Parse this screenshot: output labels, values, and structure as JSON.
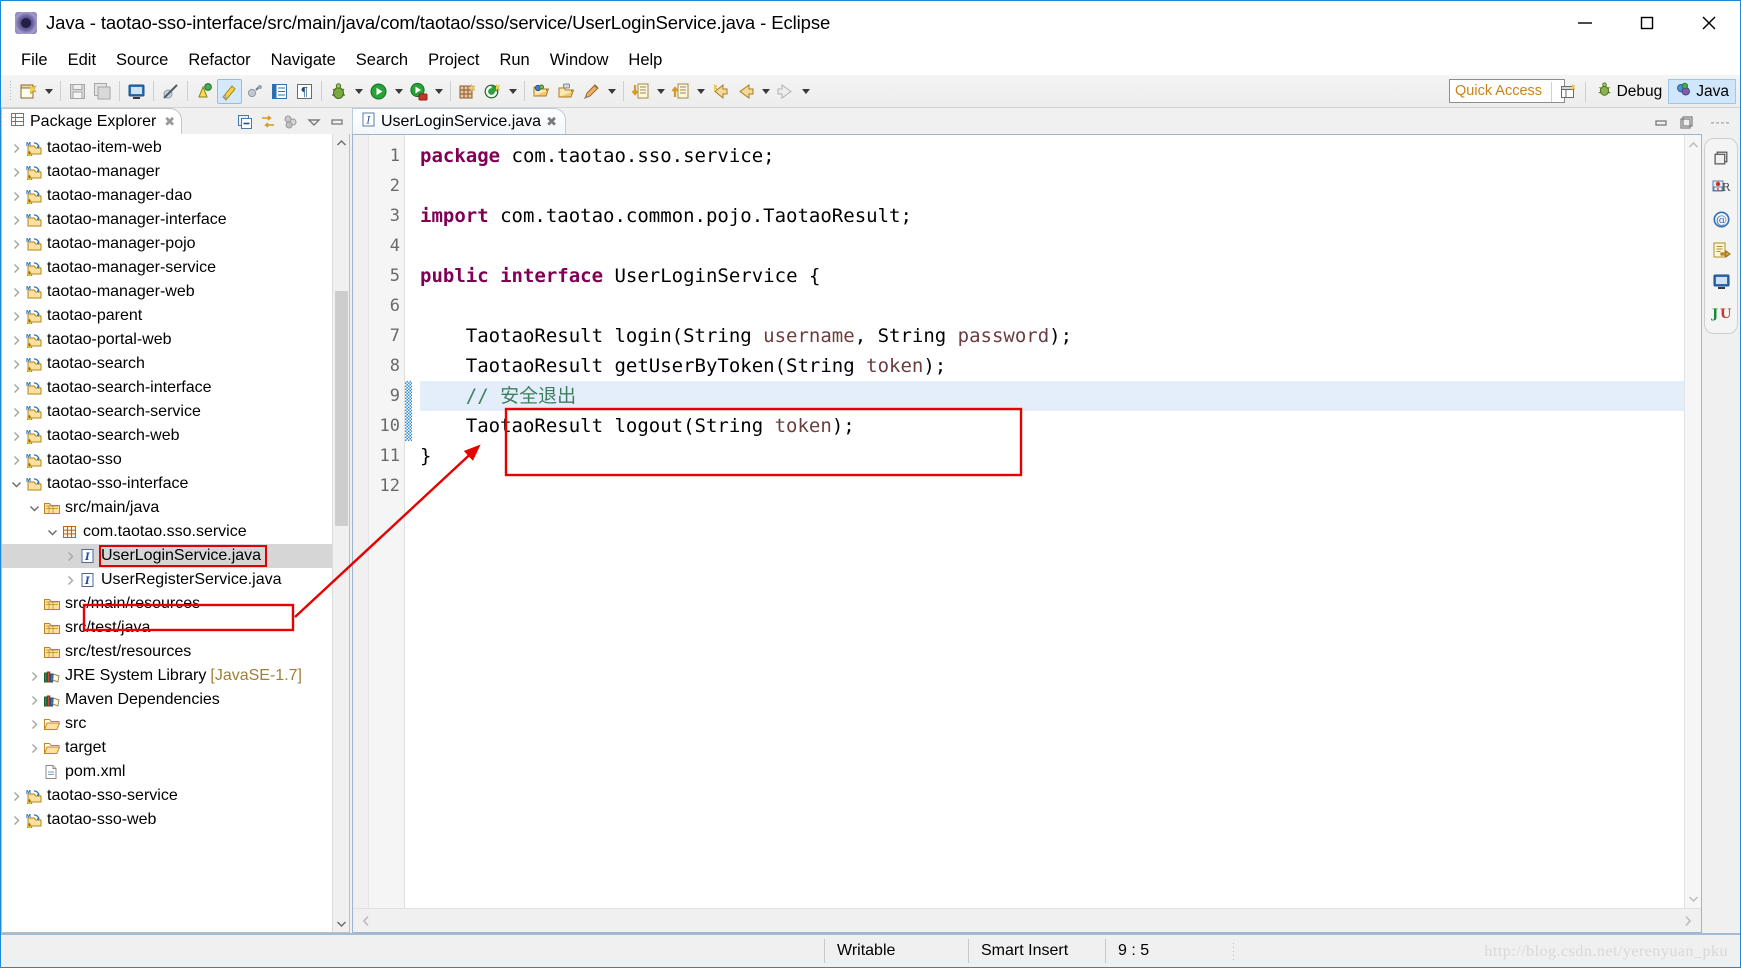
{
  "window": {
    "title": "Java - taotao-sso-interface/src/main/java/com/taotao/sso/service/UserLoginService.java - Eclipse",
    "app_icon": "eclipse-icon",
    "controls": {
      "minimize": "minimize-icon",
      "maximize": "maximize-icon",
      "close": "close-icon"
    },
    "accent_color": "#1c8ad8"
  },
  "menubar": {
    "items": [
      "File",
      "Edit",
      "Source",
      "Refactor",
      "Navigate",
      "Search",
      "Project",
      "Run",
      "Window",
      "Help"
    ]
  },
  "toolbar": {
    "quick_access_placeholder": "Quick Access",
    "groups": [
      {
        "icons": [
          "new-wizard-icon"
        ],
        "arrow": true
      },
      {
        "icons": [
          "save-icon",
          "save-all-icon"
        ],
        "arrow": false
      },
      {
        "icons": [
          "console-icon"
        ],
        "arrow": false
      },
      {
        "icons": [
          "skip-breakpoints-icon"
        ],
        "arrow": false
      },
      {
        "icons": [
          "toggle-mark-occurrences-icon",
          "highlight-icon",
          "link-icon",
          "outline-icon",
          "pilcrow-icon"
        ],
        "arrow": false
      },
      {
        "icons": [
          "debug-icon"
        ],
        "arrow": true
      },
      {
        "icons": [
          "run-icon"
        ],
        "arrow": true
      },
      {
        "icons": [
          "coverage-icon"
        ],
        "arrow": true
      },
      {
        "icons": [
          "new-java-project-icon",
          "new-package-icon"
        ],
        "arrow": true
      },
      {
        "icons": [
          "open-type-icon",
          "open-task-icon",
          "new-class-icon"
        ],
        "arrow": true
      },
      {
        "icons": [
          "previous-annotation-icon"
        ],
        "arrow": true
      },
      {
        "icons": [
          "next-annotation-icon"
        ],
        "arrow": true
      },
      {
        "icons": [
          "last-edit-location-icon",
          "back-icon"
        ],
        "arrow": true
      },
      {
        "icons": [
          "forward-icon"
        ],
        "arrow": true
      }
    ],
    "perspective": {
      "open_perspective_icon": "open-perspective-icon",
      "buttons": [
        {
          "label": "Debug",
          "icon": "debug-perspective-icon",
          "selected": false
        },
        {
          "label": "Java",
          "icon": "java-perspective-icon",
          "selected": true
        }
      ]
    }
  },
  "explorer": {
    "tab": {
      "label": "Package Explorer",
      "icon": "package-explorer-icon",
      "close": "close-icon"
    },
    "tools": [
      "collapse-all-icon",
      "link-with-editor-icon",
      "focus-on-active-task-icon",
      "view-menu-icon",
      "minimize-icon"
    ],
    "tree": [
      {
        "label": "taotao-item-web",
        "indent": 0,
        "twisty": "collapsed",
        "icon": "maven-project-warn-icon"
      },
      {
        "label": "taotao-manager",
        "indent": 0,
        "twisty": "collapsed",
        "icon": "maven-project-warn-icon"
      },
      {
        "label": "taotao-manager-dao",
        "indent": 0,
        "twisty": "collapsed",
        "icon": "maven-project-warn-icon"
      },
      {
        "label": "taotao-manager-interface",
        "indent": 0,
        "twisty": "collapsed",
        "icon": "maven-project-icon"
      },
      {
        "label": "taotao-manager-pojo",
        "indent": 0,
        "twisty": "collapsed",
        "icon": "maven-project-icon"
      },
      {
        "label": "taotao-manager-service",
        "indent": 0,
        "twisty": "collapsed",
        "icon": "maven-project-warn-icon"
      },
      {
        "label": "taotao-manager-web",
        "indent": 0,
        "twisty": "collapsed",
        "icon": "maven-project-icon"
      },
      {
        "label": "taotao-parent",
        "indent": 0,
        "twisty": "collapsed",
        "icon": "maven-project-warn-icon"
      },
      {
        "label": "taotao-portal-web",
        "indent": 0,
        "twisty": "collapsed",
        "icon": "maven-project-warn-icon"
      },
      {
        "label": "taotao-search",
        "indent": 0,
        "twisty": "collapsed",
        "icon": "maven-project-warn-icon"
      },
      {
        "label": "taotao-search-interface",
        "indent": 0,
        "twisty": "collapsed",
        "icon": "maven-project-icon"
      },
      {
        "label": "taotao-search-service",
        "indent": 0,
        "twisty": "collapsed",
        "icon": "maven-project-warn-icon"
      },
      {
        "label": "taotao-search-web",
        "indent": 0,
        "twisty": "collapsed",
        "icon": "maven-project-warn-icon"
      },
      {
        "label": "taotao-sso",
        "indent": 0,
        "twisty": "collapsed",
        "icon": "maven-project-warn-icon"
      },
      {
        "label": "taotao-sso-interface",
        "indent": 0,
        "twisty": "expanded",
        "icon": "maven-project-icon"
      },
      {
        "label": "src/main/java",
        "indent": 1,
        "twisty": "expanded",
        "icon": "source-folder-icon"
      },
      {
        "label": "com.taotao.sso.service",
        "indent": 2,
        "twisty": "expanded",
        "icon": "package-icon"
      },
      {
        "label": "UserLoginService.java",
        "indent": 3,
        "twisty": "collapsed",
        "icon": "interface-file-icon",
        "selected": true,
        "highlighted": true
      },
      {
        "label": "UserRegisterService.java",
        "indent": 3,
        "twisty": "collapsed",
        "icon": "interface-file-icon"
      },
      {
        "label": "src/main/resources",
        "indent": 1,
        "twisty": "none",
        "icon": "source-folder-icon"
      },
      {
        "label": "src/test/java",
        "indent": 1,
        "twisty": "none",
        "icon": "source-folder-icon"
      },
      {
        "label": "src/test/resources",
        "indent": 1,
        "twisty": "none",
        "icon": "source-folder-icon"
      },
      {
        "label": "JRE System Library",
        "indent": 1,
        "twisty": "collapsed",
        "icon": "library-icon",
        "suffix": "[JavaSE-1.7]"
      },
      {
        "label": "Maven Dependencies",
        "indent": 1,
        "twisty": "collapsed",
        "icon": "library-icon"
      },
      {
        "label": "src",
        "indent": 1,
        "twisty": "collapsed",
        "icon": "folder-icon"
      },
      {
        "label": "target",
        "indent": 1,
        "twisty": "collapsed",
        "icon": "folder-icon"
      },
      {
        "label": "pom.xml",
        "indent": 1,
        "twisty": "none",
        "icon": "xml-file-icon"
      },
      {
        "label": "taotao-sso-service",
        "indent": 0,
        "twisty": "collapsed",
        "icon": "maven-project-warn-icon"
      },
      {
        "label": "taotao-sso-web",
        "indent": 0,
        "twisty": "collapsed",
        "icon": "maven-project-warn-icon"
      }
    ]
  },
  "editor": {
    "tab": {
      "label": "UserLoginService.java",
      "icon": "java-interface-icon",
      "close": "close-icon"
    },
    "tools": [
      "restore-icon",
      "maximize-icon"
    ],
    "lines": [
      {
        "no": 1,
        "segments": [
          {
            "t": "package",
            "c": "kw"
          },
          {
            "t": " com.taotao.sso.service;",
            "c": ""
          }
        ]
      },
      {
        "no": 2,
        "segments": []
      },
      {
        "no": 3,
        "segments": [
          {
            "t": "import",
            "c": "kw"
          },
          {
            "t": " com.taotao.common.pojo.TaotaoResult;",
            "c": ""
          }
        ]
      },
      {
        "no": 4,
        "segments": []
      },
      {
        "no": 5,
        "segments": [
          {
            "t": "public",
            "c": "kw"
          },
          {
            "t": " ",
            "c": ""
          },
          {
            "t": "interface",
            "c": "kw"
          },
          {
            "t": " UserLoginService {",
            "c": ""
          }
        ]
      },
      {
        "no": 6,
        "segments": []
      },
      {
        "no": 7,
        "segments": [
          {
            "t": "    TaotaoResult login(String ",
            "c": ""
          },
          {
            "t": "username",
            "c": "param"
          },
          {
            "t": ", String ",
            "c": ""
          },
          {
            "t": "password",
            "c": "param"
          },
          {
            "t": ");",
            "c": ""
          }
        ]
      },
      {
        "no": 8,
        "segments": [
          {
            "t": "    TaotaoResult getUserByToken(String ",
            "c": ""
          },
          {
            "t": "token",
            "c": "param"
          },
          {
            "t": ");",
            "c": ""
          }
        ]
      },
      {
        "no": 9,
        "segments": [
          {
            "t": "    // 安全退出",
            "c": "cmt"
          }
        ],
        "highlighted": true
      },
      {
        "no": 10,
        "segments": [
          {
            "t": "    TaotaoResult logout(String ",
            "c": ""
          },
          {
            "t": "token",
            "c": "param"
          },
          {
            "t": ");",
            "c": ""
          }
        ]
      },
      {
        "no": 11,
        "segments": [
          {
            "t": "}",
            "c": ""
          }
        ]
      },
      {
        "no": 12,
        "segments": []
      }
    ]
  },
  "fastview": {
    "icons": [
      "restore-icon",
      "problems-icon",
      "at-icon",
      "properties-icon",
      "console-icon",
      "junit-icon"
    ]
  },
  "statusbar": {
    "writable": "Writable",
    "insert_mode": "Smart Insert",
    "position": "9 : 5",
    "watermark": "http://blog.csdn.net/yerenyuan_pku"
  },
  "annotations": {
    "box_code_color": "#e60000",
    "box_tree_color": "#e60000",
    "arrow_color": "#e60000"
  }
}
